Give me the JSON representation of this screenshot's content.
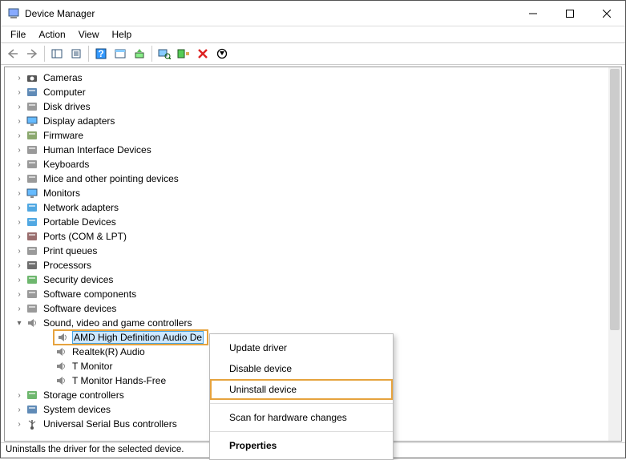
{
  "title": "Device Manager",
  "menus": [
    "File",
    "Action",
    "View",
    "Help"
  ],
  "tree": {
    "items": [
      {
        "label": "Cameras",
        "icon": "camera"
      },
      {
        "label": "Computer",
        "icon": "computer"
      },
      {
        "label": "Disk drives",
        "icon": "disk"
      },
      {
        "label": "Display adapters",
        "icon": "display"
      },
      {
        "label": "Firmware",
        "icon": "firmware"
      },
      {
        "label": "Human Interface Devices",
        "icon": "hid"
      },
      {
        "label": "Keyboards",
        "icon": "keyboard"
      },
      {
        "label": "Mice and other pointing devices",
        "icon": "mouse"
      },
      {
        "label": "Monitors",
        "icon": "monitor"
      },
      {
        "label": "Network adapters",
        "icon": "network"
      },
      {
        "label": "Portable Devices",
        "icon": "portable"
      },
      {
        "label": "Ports (COM & LPT)",
        "icon": "port"
      },
      {
        "label": "Print queues",
        "icon": "printer"
      },
      {
        "label": "Processors",
        "icon": "cpu"
      },
      {
        "label": "Security devices",
        "icon": "security"
      },
      {
        "label": "Software components",
        "icon": "swc"
      },
      {
        "label": "Software devices",
        "icon": "swd"
      },
      {
        "label": "Sound, video and game controllers",
        "icon": "sound",
        "expanded": true,
        "children": [
          {
            "label": "AMD High Definition Audio De",
            "icon": "speaker",
            "selected": true,
            "highlight": true
          },
          {
            "label": "Realtek(R) Audio",
            "icon": "speaker"
          },
          {
            "label": "T Monitor",
            "icon": "speaker"
          },
          {
            "label": "T Monitor Hands-Free",
            "icon": "speaker"
          }
        ]
      },
      {
        "label": "Storage controllers",
        "icon": "storage"
      },
      {
        "label": "System devices",
        "icon": "system"
      },
      {
        "label": "Universal Serial Bus controllers",
        "icon": "usb"
      }
    ]
  },
  "context_menu": {
    "items": [
      "Update driver",
      "Disable device",
      "Uninstall device",
      "-",
      "Scan for hardware changes",
      "-",
      "Properties"
    ],
    "highlight_index": 2,
    "bold_index": 6
  },
  "status": "Uninstalls the driver for the selected device."
}
